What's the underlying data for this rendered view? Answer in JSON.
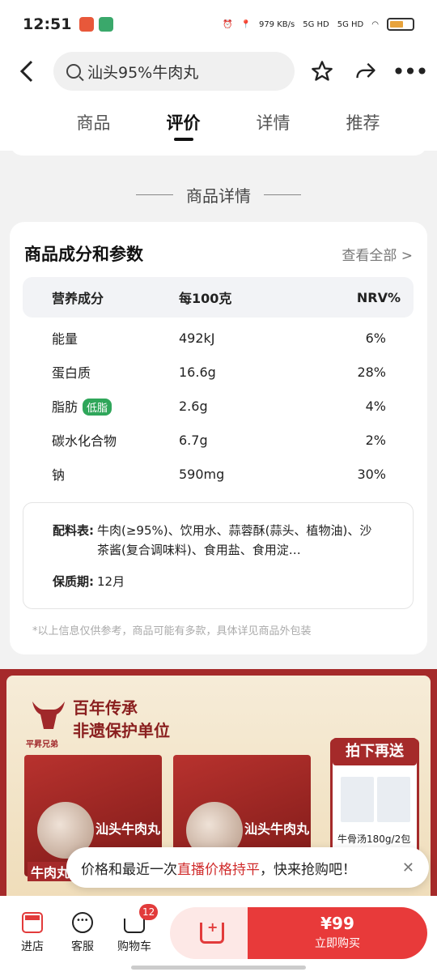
{
  "status_bar": {
    "time": "12:51",
    "network_speed": "979",
    "network_speed_unit": "KB/s",
    "signal1": "5G HD",
    "signal2": "5G HD"
  },
  "header": {
    "search_text": "汕头95%牛肉丸"
  },
  "tabs": [
    "商品",
    "评价",
    "详情",
    "推荐"
  ],
  "active_tab": "评价",
  "section_title": "商品详情",
  "card": {
    "title": "商品成分和参数",
    "view_all": "查看全部 >",
    "nutrition": {
      "headers": [
        "营养成分",
        "每100克",
        "NRV%"
      ],
      "rows": [
        {
          "name": "能量",
          "per100": "492kJ",
          "nrv": "6%"
        },
        {
          "name": "蛋白质",
          "per100": "16.6g",
          "nrv": "28%"
        },
        {
          "name": "脂肪",
          "badge": "低脂",
          "per100": "2.6g",
          "nrv": "4%"
        },
        {
          "name": "碳水化合物",
          "per100": "6.7g",
          "nrv": "2%"
        },
        {
          "name": "钠",
          "per100": "590mg",
          "nrv": "30%"
        }
      ]
    },
    "ingredients_label": "配料表:",
    "ingredients_text": "牛肉(≥95%)、饮用水、蒜蓉酥(蒜头、植物油)、沙茶酱(复合调味料)、食用盐、食用淀…",
    "shelf_label": "保质期:",
    "shelf_value": "12月",
    "disclaimer": "*以上信息仅供参考，商品可能有多款，具体详见商品外包装"
  },
  "promo": {
    "brand": "平昇兄弟",
    "slogan_line1": "百年传承",
    "slogan_line2": "非遗保护单位",
    "product_name": "汕头牛肉丸",
    "gift_title": "拍下再送",
    "gift_caption": "牛骨汤180g/2包",
    "tag": "牛肉丸"
  },
  "toast": {
    "prefix": "价格和最近一次",
    "highlight": "直播价格持平",
    "suffix": "，快来抢购吧！"
  },
  "bottom": {
    "store": "进店",
    "service": "客服",
    "cart": "购物车",
    "cart_count": "12",
    "price": "¥99",
    "buy_label": "立即购买"
  },
  "colors": {
    "accent": "#e83a3a",
    "badge_green": "#2fa65a",
    "promo_red": "#a52a2a"
  }
}
